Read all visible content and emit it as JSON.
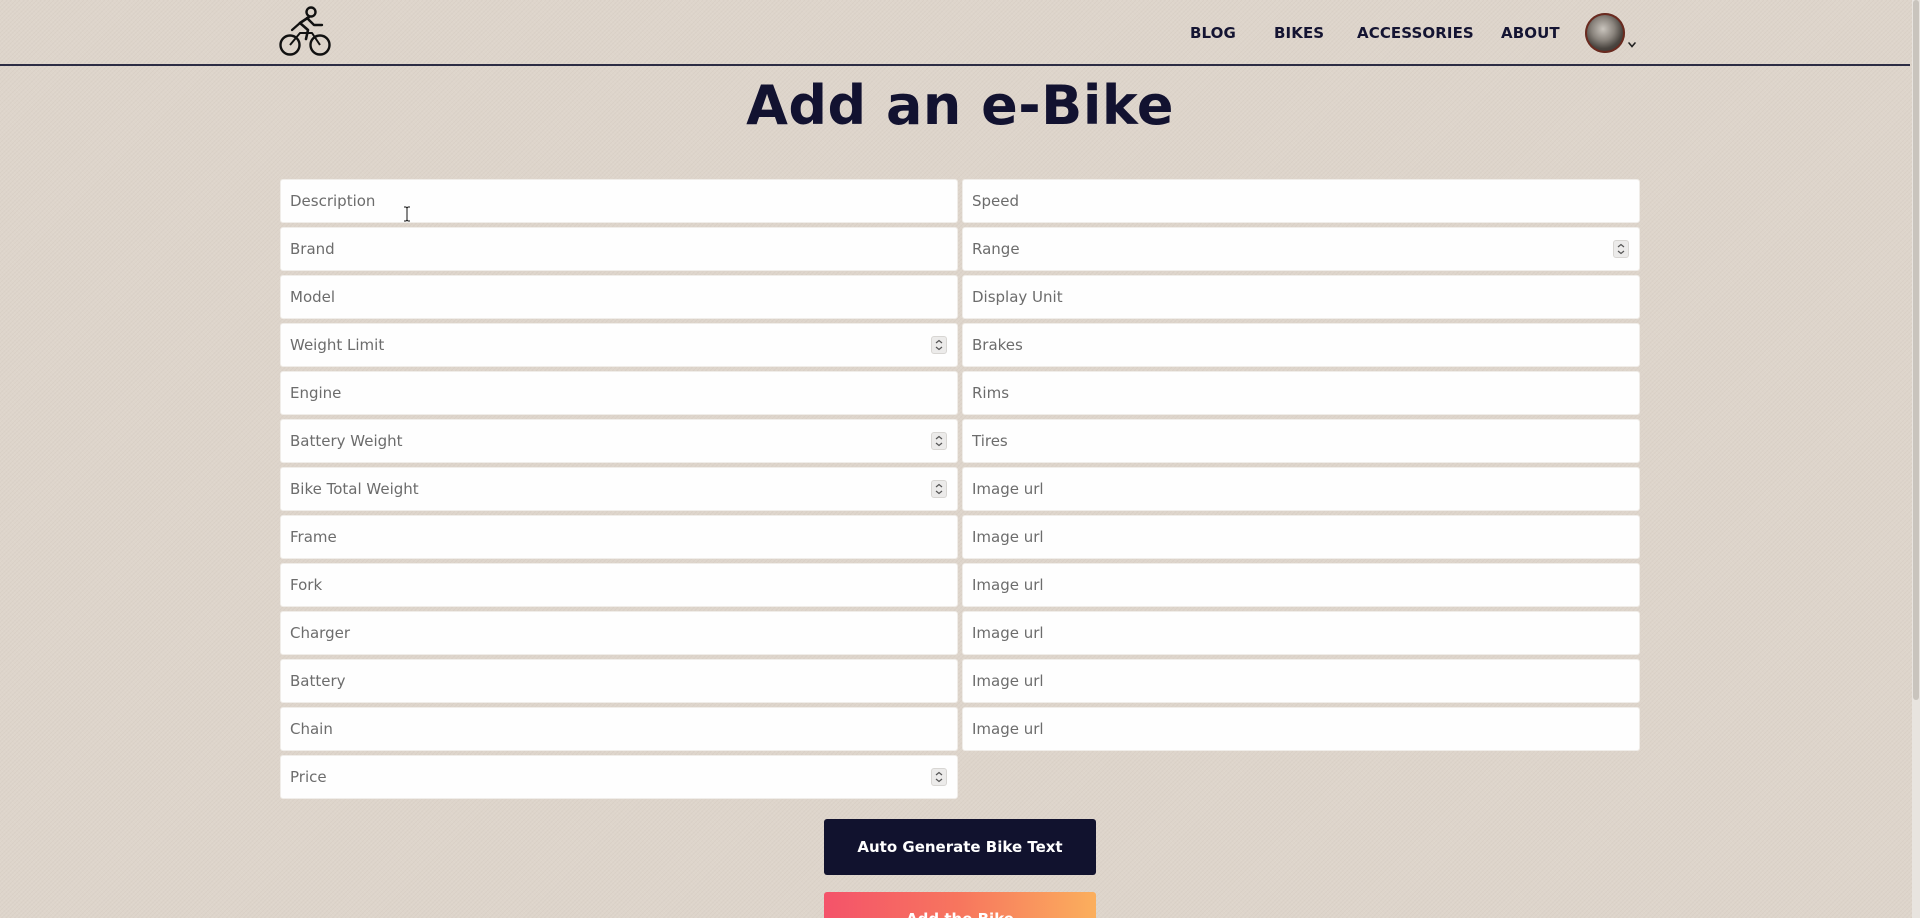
{
  "nav": {
    "links": [
      "BLOG",
      "BIKES",
      "ACCESSORIES",
      "ABOUT"
    ]
  },
  "page": {
    "title": "Add an e-Bike"
  },
  "form": {
    "left": [
      {
        "placeholder": "Description",
        "type": "text"
      },
      {
        "placeholder": "Brand",
        "type": "text"
      },
      {
        "placeholder": "Model",
        "type": "text"
      },
      {
        "placeholder": "Weight Limit",
        "type": "number"
      },
      {
        "placeholder": "Engine",
        "type": "text"
      },
      {
        "placeholder": "Battery Weight",
        "type": "number"
      },
      {
        "placeholder": "Bike Total Weight",
        "type": "number"
      },
      {
        "placeholder": "Frame",
        "type": "text"
      },
      {
        "placeholder": "Fork",
        "type": "text"
      },
      {
        "placeholder": "Charger",
        "type": "text"
      },
      {
        "placeholder": "Battery",
        "type": "text"
      },
      {
        "placeholder": "Chain",
        "type": "text"
      },
      {
        "placeholder": "Price",
        "type": "number"
      }
    ],
    "right": [
      {
        "placeholder": "Speed",
        "type": "text"
      },
      {
        "placeholder": "Range",
        "type": "number"
      },
      {
        "placeholder": "Display Unit",
        "type": "text"
      },
      {
        "placeholder": "Brakes",
        "type": "text"
      },
      {
        "placeholder": "Rims",
        "type": "text"
      },
      {
        "placeholder": "Tires",
        "type": "text"
      },
      {
        "placeholder": "Image url",
        "type": "text"
      },
      {
        "placeholder": "Image url",
        "type": "text"
      },
      {
        "placeholder": "Image url",
        "type": "text"
      },
      {
        "placeholder": "Image url",
        "type": "text"
      },
      {
        "placeholder": "Image url",
        "type": "text"
      },
      {
        "placeholder": "Image url",
        "type": "text"
      }
    ]
  },
  "buttons": {
    "generate_label": "Auto Generate Bike Text",
    "add_label": "Add the Bike"
  },
  "colors": {
    "background": "#ded5cb",
    "title": "#121230",
    "generate_button": "#11122e",
    "add_button_gradient": [
      "#f4536a",
      "#fbaf5d"
    ]
  },
  "icons": {
    "logo": "cyclist-logo-icon",
    "avatar_caret": "chevron-down-icon",
    "spinner": "number-spinner-icon",
    "cursor": "text-cursor-icon"
  }
}
